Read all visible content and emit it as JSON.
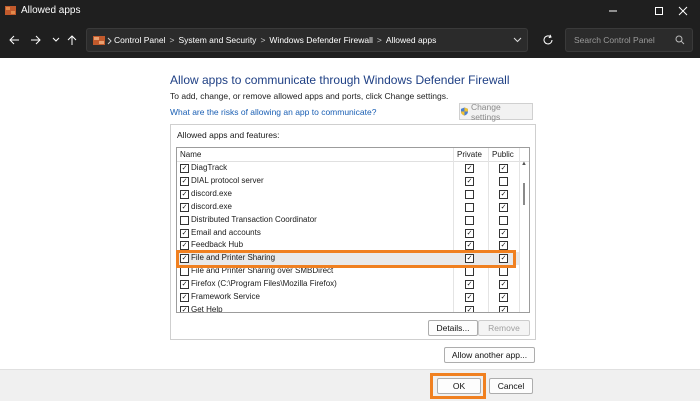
{
  "window": {
    "title": "Allowed apps",
    "app_icon": "firewall-icon"
  },
  "window_controls": {
    "minimize": "minimize-icon",
    "maximize": "maximize-icon",
    "close": "close-icon"
  },
  "nav": {
    "back": "arrow-left-icon",
    "forward": "arrow-right-icon",
    "dropdown": "chevron-down-icon",
    "up": "arrow-up-icon",
    "refresh": "refresh-icon"
  },
  "address": {
    "crumbs": [
      "Control Panel",
      "System and Security",
      "Windows Defender Firewall",
      "Allowed apps"
    ],
    "separator": ">"
  },
  "search": {
    "placeholder": "Search Control Panel"
  },
  "content": {
    "heading": "Allow apps to communicate through Windows Defender Firewall",
    "subtext": "To add, change, or remove allowed apps and ports, click Change settings.",
    "risk_link": "What are the risks of allowing an app to communicate?",
    "change_settings": "Change settings"
  },
  "apps": {
    "group_title": "Allowed apps and features:",
    "columns": {
      "name": "Name",
      "private": "Private",
      "public": "Public"
    },
    "rows": [
      {
        "name": "DiagTrack",
        "enabled": true,
        "private": true,
        "public": true
      },
      {
        "name": "DIAL protocol server",
        "enabled": true,
        "private": true,
        "public": false
      },
      {
        "name": "discord.exe",
        "enabled": true,
        "private": false,
        "public": true
      },
      {
        "name": "discord.exe",
        "enabled": true,
        "private": false,
        "public": true
      },
      {
        "name": "Distributed Transaction Coordinator",
        "enabled": false,
        "private": false,
        "public": false
      },
      {
        "name": "Email and accounts",
        "enabled": true,
        "private": true,
        "public": true
      },
      {
        "name": "Feedback Hub",
        "enabled": true,
        "private": true,
        "public": true
      },
      {
        "name": "File and Printer Sharing",
        "enabled": true,
        "private": true,
        "public": true,
        "selected": true
      },
      {
        "name": "File and Printer Sharing over SMBDirect",
        "enabled": false,
        "private": false,
        "public": false
      },
      {
        "name": "Firefox (C:\\Program Files\\Mozilla Firefox)",
        "enabled": true,
        "private": true,
        "public": true
      },
      {
        "name": "Framework Service",
        "enabled": true,
        "private": true,
        "public": true
      },
      {
        "name": "Get Help",
        "enabled": true,
        "private": true,
        "public": true
      }
    ],
    "details_button": "Details...",
    "remove_button": "Remove"
  },
  "allow_another_button": "Allow another app...",
  "footer": {
    "ok": "OK",
    "cancel": "Cancel"
  },
  "colors": {
    "highlight": "#f08020",
    "heading": "#1e3f84",
    "link": "#1a5fb4",
    "titlebar": "#1f1f1f"
  }
}
